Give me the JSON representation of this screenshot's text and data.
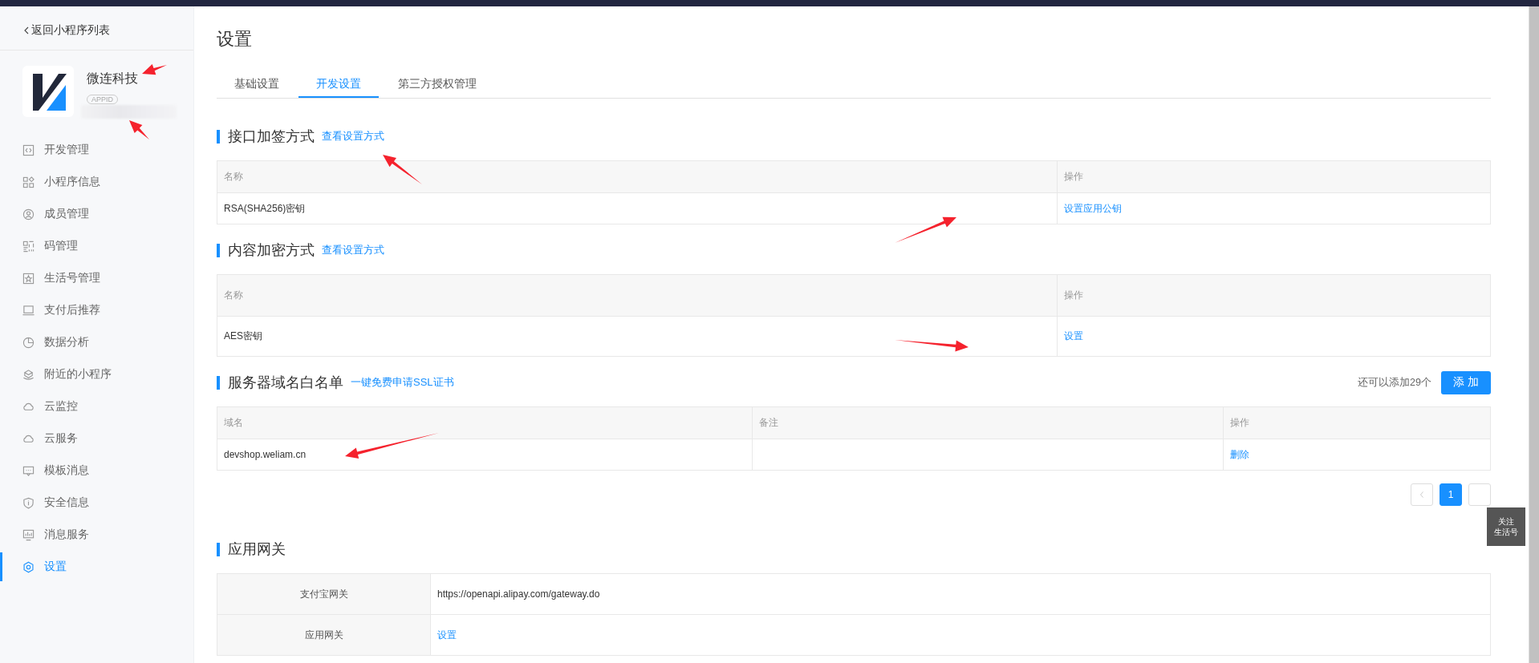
{
  "sidebar": {
    "back_link": "返回小程序列表",
    "app": {
      "name": "微连科技",
      "badge": "APPID"
    },
    "items": [
      {
        "label": "开发管理",
        "selected": false
      },
      {
        "label": "小程序信息",
        "selected": false
      },
      {
        "label": "成员管理",
        "selected": false
      },
      {
        "label": "码管理",
        "selected": false
      },
      {
        "label": "生活号管理",
        "selected": false
      },
      {
        "label": "支付后推荐",
        "selected": false
      },
      {
        "label": "数据分析",
        "selected": false
      },
      {
        "label": "附近的小程序",
        "selected": false
      },
      {
        "label": "云监控",
        "selected": false
      },
      {
        "label": "云服务",
        "selected": false
      },
      {
        "label": "模板消息",
        "selected": false
      },
      {
        "label": "安全信息",
        "selected": false
      },
      {
        "label": "消息服务",
        "selected": false
      },
      {
        "label": "设置",
        "selected": true
      }
    ]
  },
  "page_title": "设置",
  "tabs": [
    {
      "label": "基础设置",
      "selected": false
    },
    {
      "label": "开发设置",
      "selected": true
    },
    {
      "label": "第三方授权管理",
      "selected": false
    }
  ],
  "sections": [
    {
      "title": "接口加签方式",
      "link": "查看设置方式",
      "columns": [
        "名称",
        "操作"
      ],
      "rows": [
        [
          "RSA(SHA256)密钥",
          "设置应用公钥"
        ]
      ]
    },
    {
      "title": "内容加密方式",
      "link": "查看设置方式",
      "columns": [
        "名称",
        "操作"
      ],
      "rows": [
        [
          "AES密钥",
          "设置"
        ]
      ]
    },
    {
      "title": "服务器域名白名单",
      "link": "一键免费申请SSL证书",
      "remaining": "还可以添加29个",
      "add_button": "添 加",
      "columns": [
        "域名",
        "备注",
        "操作"
      ],
      "rows": [
        [
          "devshop.weliam.cn",
          "",
          "删除"
        ]
      ],
      "pagination": {
        "pages": [
          {
            "label": "1",
            "selected": true
          }
        ]
      }
    }
  ],
  "gateway": {
    "title": "应用网关",
    "rows": [
      {
        "label": "支付宝网关",
        "value": "https://openapi.alipay.com/gateway.do",
        "kind": "text"
      },
      {
        "label": "应用网关",
        "value": "设置",
        "kind": "link"
      }
    ]
  },
  "float_button": [
    "关注",
    "生活号"
  ]
}
